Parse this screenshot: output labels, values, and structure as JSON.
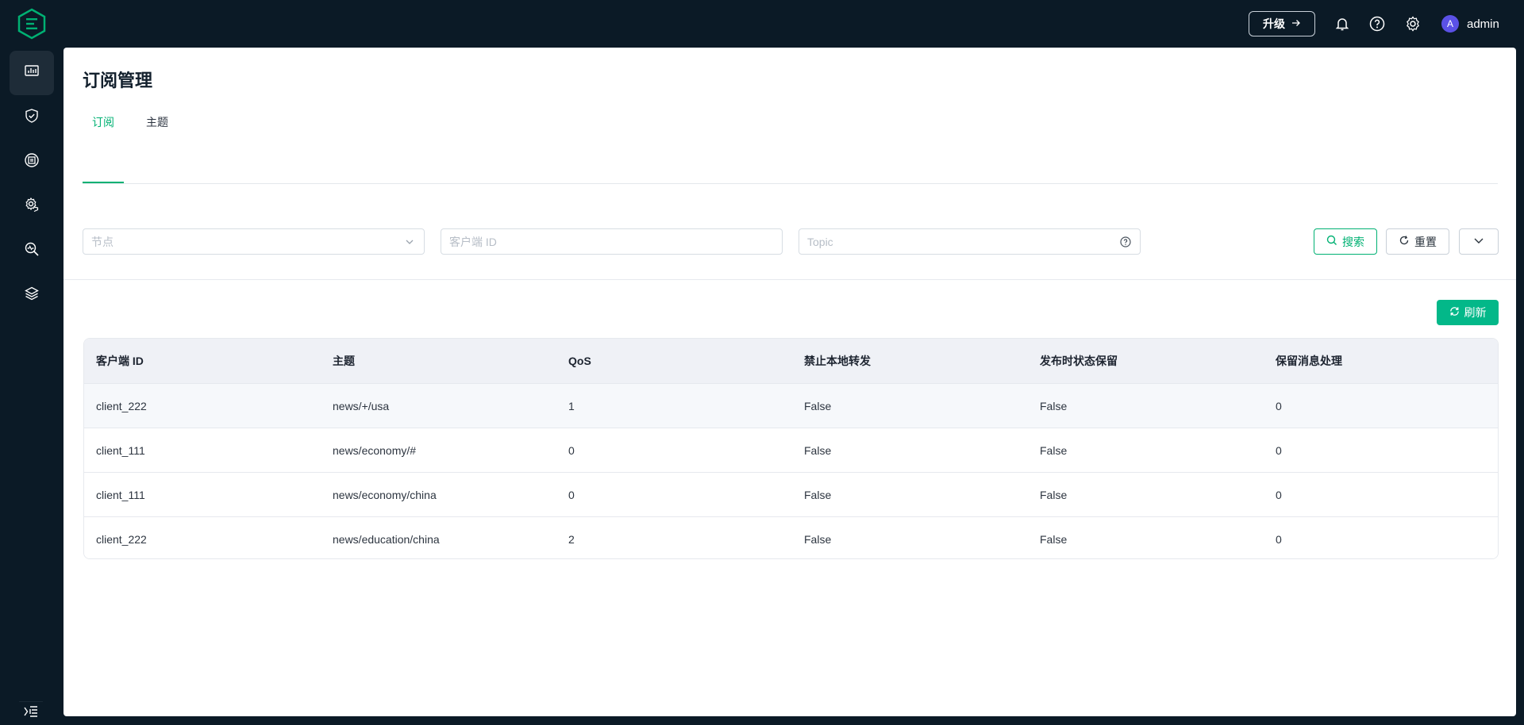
{
  "header": {
    "upgrade_label": "升级",
    "user_initial": "A",
    "username": "admin"
  },
  "page": {
    "title": "订阅管理",
    "tabs": [
      {
        "label": "订阅",
        "active": true
      },
      {
        "label": "主题",
        "active": false
      }
    ]
  },
  "filters": {
    "node_placeholder": "节点",
    "client_placeholder": "客户端 ID",
    "topic_placeholder": "Topic",
    "search_label": "搜索",
    "reset_label": "重置"
  },
  "actions": {
    "refresh_label": "刷新"
  },
  "table": {
    "columns": [
      "客户端 ID",
      "主题",
      "QoS",
      "禁止本地转发",
      "发布时状态保留",
      "保留消息处理"
    ],
    "rows": [
      [
        "client_222",
        "news/+/usa",
        "1",
        "False",
        "False",
        "0"
      ],
      [
        "client_111",
        "news/economy/#",
        "0",
        "False",
        "False",
        "0"
      ],
      [
        "client_111",
        "news/economy/china",
        "0",
        "False",
        "False",
        "0"
      ],
      [
        "client_222",
        "news/education/china",
        "2",
        "False",
        "False",
        "0"
      ]
    ]
  },
  "colors": {
    "accent": "#00b173",
    "nav_bg": "#0b1a26",
    "avatar": "#5b51e6"
  },
  "icons": {
    "nav": [
      "dashboard-icon",
      "shield-check-icon",
      "subscription-icon",
      "gear-shield-icon",
      "diagnose-icon",
      "layers-icon"
    ]
  }
}
